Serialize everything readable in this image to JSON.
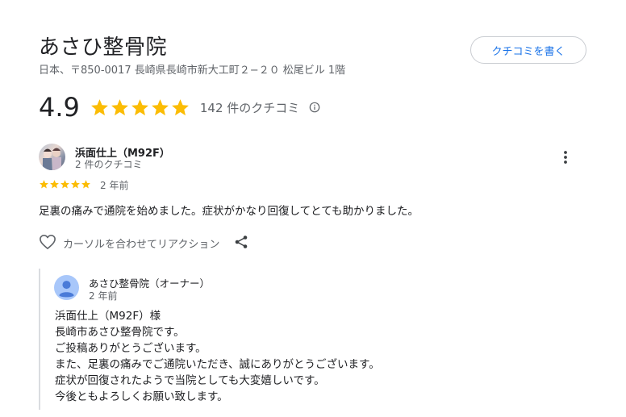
{
  "header": {
    "title": "あさひ整骨院",
    "address": "日本、〒850-0017 長崎県長崎市新大工町２−２０ 松尾ビル 1階",
    "write_review_label": "クチコミを書く"
  },
  "rating": {
    "value": "4.9",
    "stars": 5,
    "count_label": "142 件のクチコミ"
  },
  "review": {
    "reviewer_name": "浜面仕上（M92F）",
    "reviewer_sub": "2 件のクチコミ",
    "stars": 5,
    "date": "2 年前",
    "text": "足裏の痛みで通院を始めました。症状がかなり回復してとても助かりました。",
    "reaction_label": "カーソルを合わせてリアクション"
  },
  "reply": {
    "owner_name": "あさひ整骨院（オーナー）",
    "date": "2 年前",
    "lines": [
      "浜面仕上（M92F）様",
      "長崎市あさひ整骨院です。",
      "ご投稿ありがとうございます。",
      "また、足裏の痛みでご通院いただき、誠にありがとうございます。",
      "症状が回復されたようで当院としても大変嬉しいです。",
      "今後ともよろしくお願い致します。"
    ]
  },
  "colors": {
    "star": "#fbbc04",
    "link": "#1a73e8",
    "muted": "#5f6368"
  }
}
